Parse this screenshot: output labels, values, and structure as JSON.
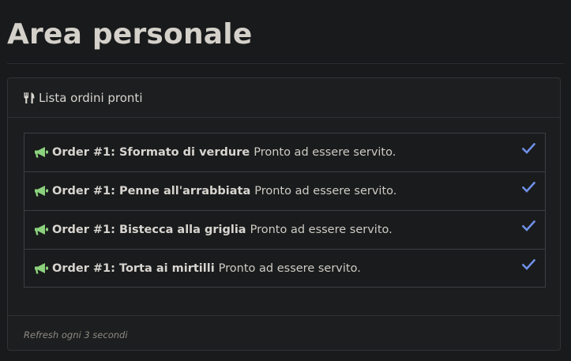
{
  "page": {
    "title": "Area personale"
  },
  "card": {
    "header_icon": "utensils-icon",
    "header_title": "Lista ordini pronti",
    "footer_text": "Refresh ogni 3 secondi"
  },
  "orders": [
    {
      "label": "Order #1: Sformato di verdure",
      "status": "Pronto ad essere servito.",
      "icon": "megaphone-icon",
      "action_icon": "check-icon"
    },
    {
      "label": "Order #1: Penne all'arrabbiata",
      "status": "Pronto ad essere servito.",
      "icon": "megaphone-icon",
      "action_icon": "check-icon"
    },
    {
      "label": "Order #1: Bistecca alla griglia",
      "status": "Pronto ad essere servito.",
      "icon": "megaphone-icon",
      "action_icon": "check-icon"
    },
    {
      "label": "Order #1: Torta ai mirtilli",
      "status": "Pronto ad essere servito.",
      "icon": "megaphone-icon",
      "action_icon": "check-icon"
    }
  ],
  "colors": {
    "background": "#181a1b",
    "megaphone": "#8cd17d",
    "check": "#6f8fe6"
  }
}
